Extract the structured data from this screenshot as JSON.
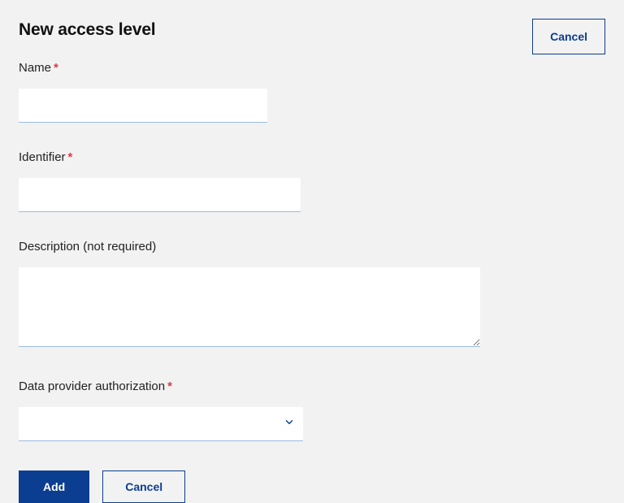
{
  "page": {
    "title": "New access level",
    "top_cancel": "Cancel"
  },
  "form": {
    "name_label": "Name",
    "name_value": "",
    "identifier_label": "Identifier",
    "identifier_value": "",
    "description_label": "Description (not required)",
    "description_value": "",
    "provider_label": "Data provider authorization",
    "provider_value": "",
    "required_marker": "*"
  },
  "actions": {
    "add": "Add",
    "cancel": "Cancel"
  },
  "colors": {
    "primary": "#0b3d91",
    "required": "#d73a49",
    "input_border": "#9bbce0",
    "background": "#f2f2f2"
  }
}
